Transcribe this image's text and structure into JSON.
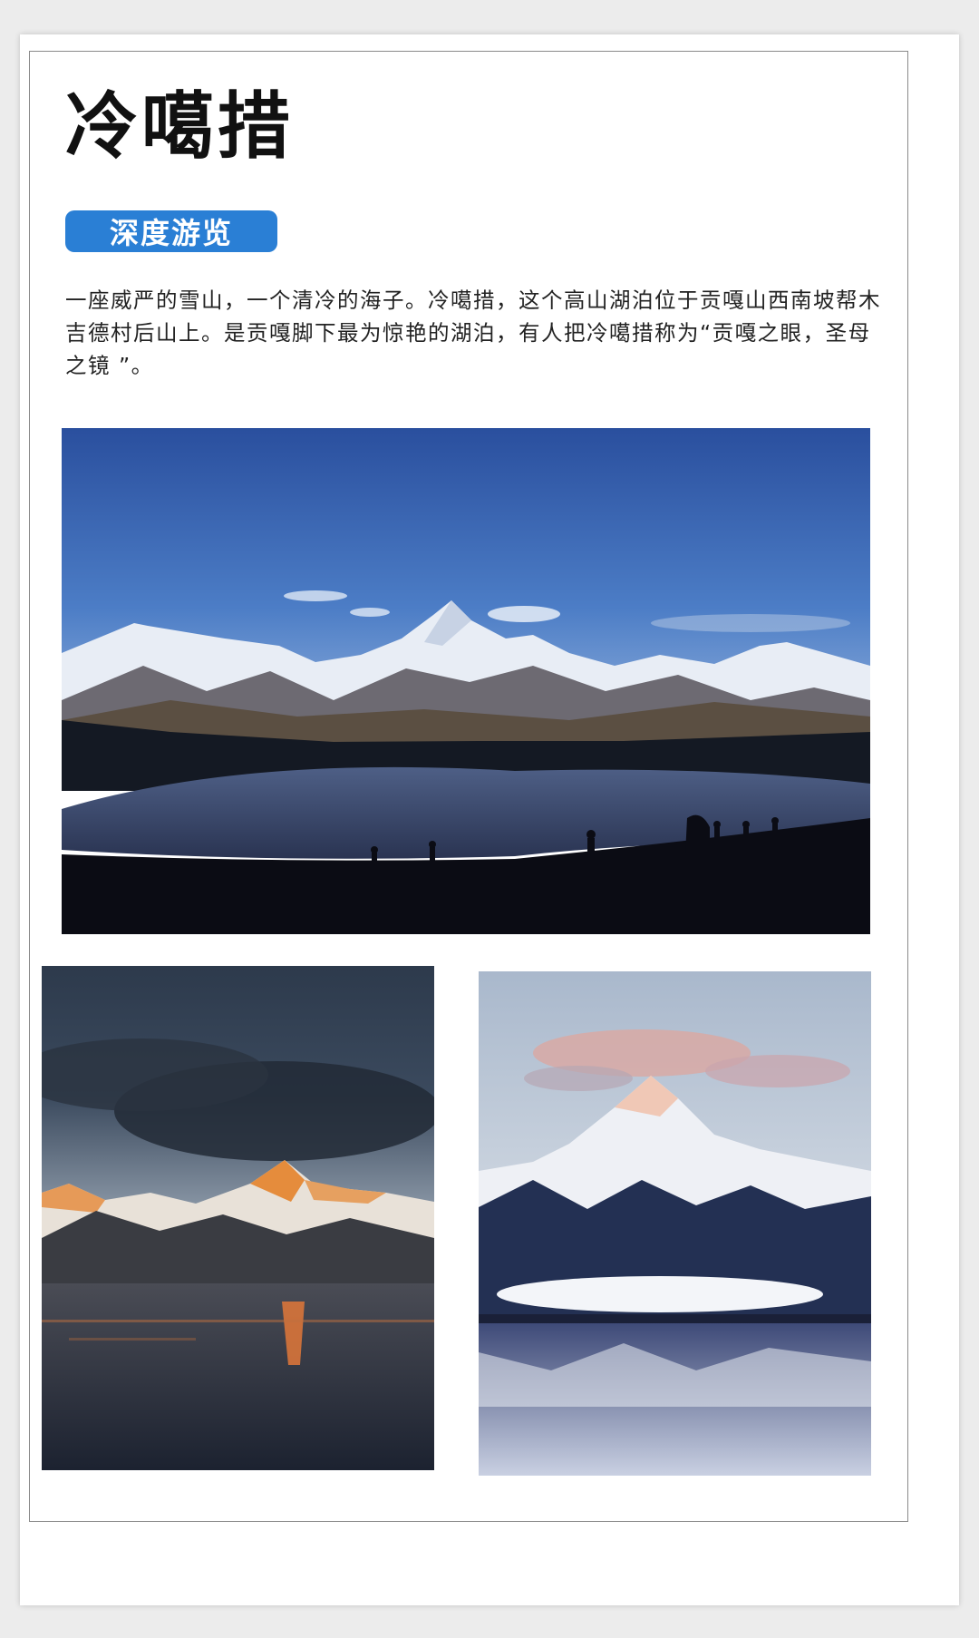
{
  "article": {
    "title": "冷噶措",
    "tag_label": "深度游览",
    "description": "一座威严的雪山，一个清冷的海子。冷噶措，这个高山湖泊位于贡嘎山西南坡帮木吉德村后山上。是贡嘎脚下最为惊艳的湖泊，有人把冷噶措称为“贡嘎之眼，圣母之镜 ”。"
  },
  "colors": {
    "tag_background": "#2a7fd5",
    "frame_border": "#8a8a8a"
  },
  "photos": [
    {
      "name": "lake-panorama-photo",
      "subject": "snow mountain range above dark lake with silhouetted hikers"
    },
    {
      "name": "sunset-peak-photo",
      "subject": "golden peak at dusk reflected in lake"
    },
    {
      "name": "pink-cloud-peak-photo",
      "subject": "snowy peak with pink clouds reflected in lake"
    }
  ]
}
